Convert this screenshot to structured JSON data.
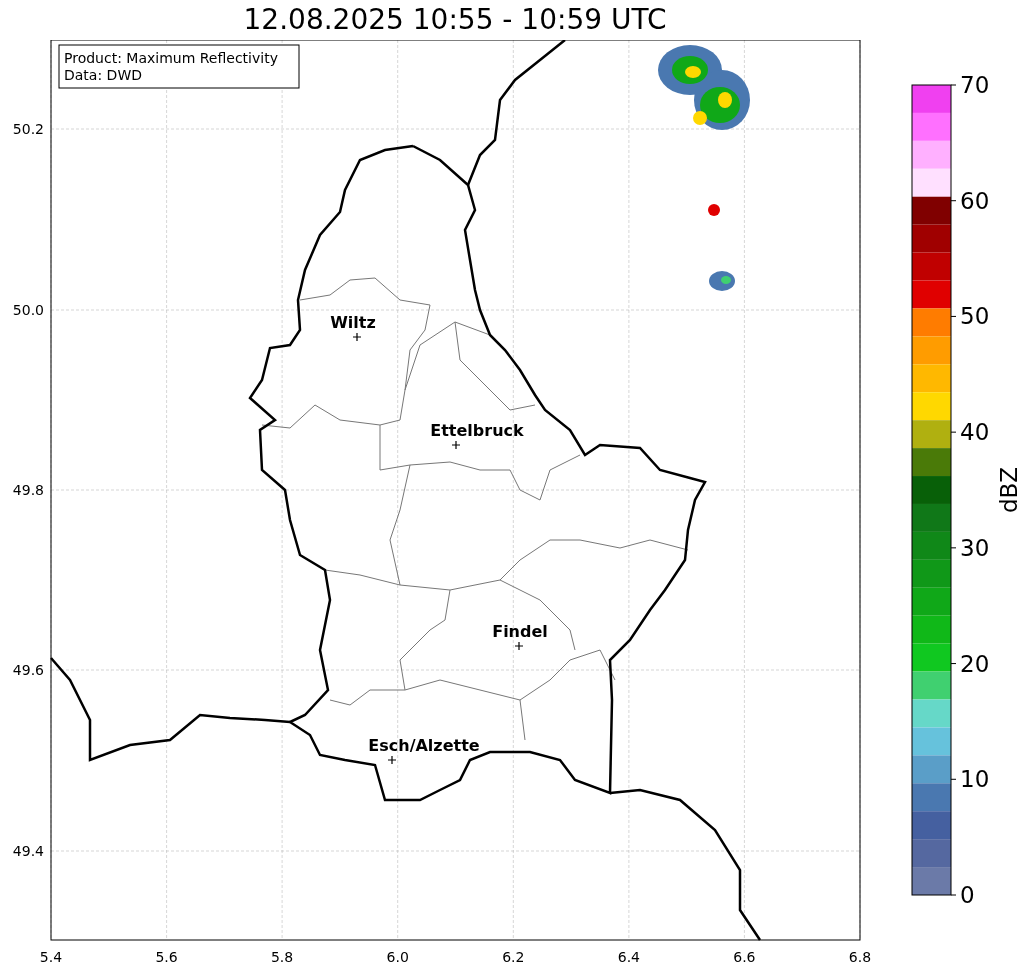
{
  "title": "12.08.2025 10:55 - 10:59 UTC",
  "info_box": [
    "Product: Maximum Reflectivity",
    "Data: DWD"
  ],
  "map": {
    "x_tick_labels": [
      "5.4",
      "5.6",
      "5.8",
      "6.0",
      "6.2",
      "6.4",
      "6.6",
      "6.8"
    ],
    "y_tick_labels": [
      "50.2",
      "50.0",
      "49.8",
      "49.6",
      "49.4"
    ],
    "cities": [
      {
        "label": "Wiltz"
      },
      {
        "label": "Ettelbruck"
      },
      {
        "label": "Findel"
      },
      {
        "label": "Esch/Alzette"
      }
    ]
  },
  "colorbar": {
    "label": "dBZ",
    "ticks": [
      "70",
      "60",
      "50",
      "40",
      "30",
      "20",
      "10",
      "0"
    ],
    "bins": [
      {
        "color": "#f040f0"
      },
      {
        "color": "#ff70ff"
      },
      {
        "color": "#ffb0ff"
      },
      {
        "color": "#ffe0ff"
      },
      {
        "color": "#800000"
      },
      {
        "color": "#a00000"
      },
      {
        "color": "#c00000"
      },
      {
        "color": "#e00000"
      },
      {
        "color": "#ff7c00"
      },
      {
        "color": "#ff9c00"
      },
      {
        "color": "#ffb800"
      },
      {
        "color": "#ffd800"
      },
      {
        "color": "#b0b010"
      },
      {
        "color": "#4a7a08"
      },
      {
        "color": "#086008"
      },
      {
        "color": "#107818"
      },
      {
        "color": "#108818"
      },
      {
        "color": "#109818"
      },
      {
        "color": "#10a818"
      },
      {
        "color": "#10b818"
      },
      {
        "color": "#10c820"
      },
      {
        "color": "#40d070"
      },
      {
        "color": "#66d8c8"
      },
      {
        "color": "#66c2dc"
      },
      {
        "color": "#5a9ec8"
      },
      {
        "color": "#4a78b0"
      },
      {
        "color": "#4560a0"
      },
      {
        "color": "#5568a0"
      },
      {
        "color": "#6b7aa8"
      }
    ]
  }
}
